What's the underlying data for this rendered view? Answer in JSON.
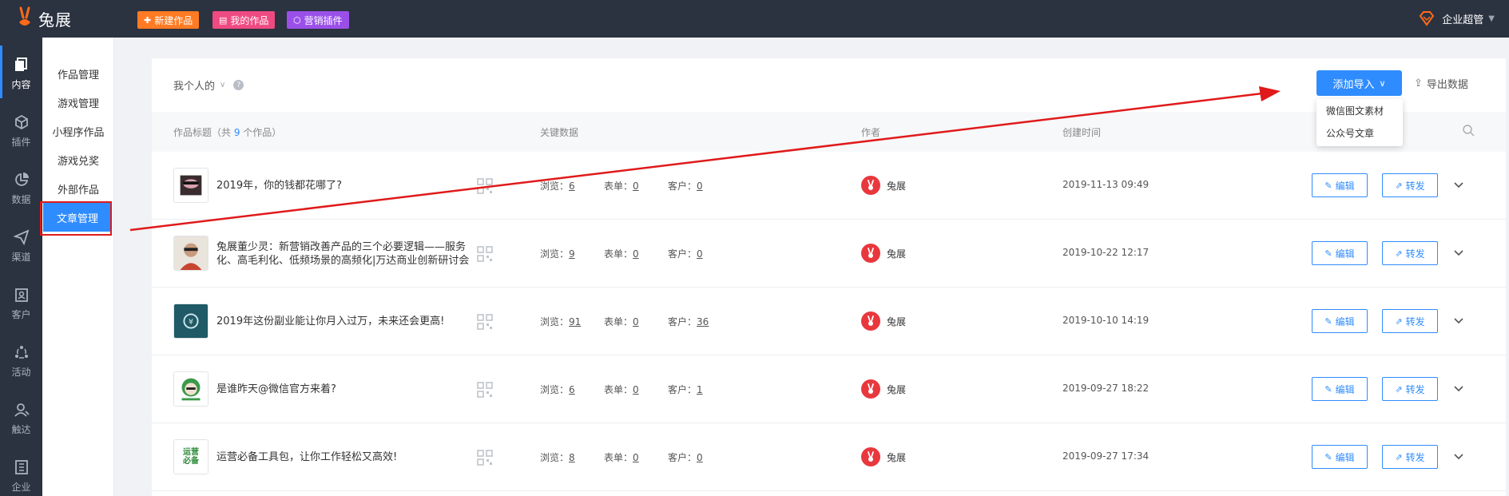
{
  "app": {
    "brand": "兔展"
  },
  "topbar": {
    "new_work": "新建作品",
    "my_works": "我的作品",
    "marketing_plugins": "营销插件",
    "user_label": "企业超管"
  },
  "rail": [
    {
      "label": "内容",
      "icon": "content-icon",
      "active": true
    },
    {
      "label": "插件",
      "icon": "plugin-icon"
    },
    {
      "label": "数据",
      "icon": "data-icon"
    },
    {
      "label": "渠道",
      "icon": "channel-icon"
    },
    {
      "label": "客户",
      "icon": "customer-icon"
    },
    {
      "label": "活动",
      "icon": "activity-icon"
    },
    {
      "label": "触达",
      "icon": "reach-icon"
    },
    {
      "label": "企业",
      "icon": "enterprise-icon"
    }
  ],
  "subnav": [
    {
      "label": "作品管理"
    },
    {
      "label": "游戏管理"
    },
    {
      "label": "小程序作品"
    },
    {
      "label": "游戏兑奖"
    },
    {
      "label": "外部作品"
    },
    {
      "label": "文章管理",
      "active": true
    }
  ],
  "toolbar": {
    "filter_label": "我个人的",
    "add_import": "添加导入",
    "export": "导出数据",
    "dropdown": [
      "微信图文素材",
      "公众号文章"
    ]
  },
  "table": {
    "col_title_prefix": "作品标题（共 ",
    "col_title_count": "9",
    "col_title_suffix": " 个作品）",
    "col_key_data": "关键数据",
    "col_author": "作者",
    "col_created": "创建时间",
    "views_label": "浏览：",
    "forms_label": "表单：",
    "customers_label": "客户：",
    "edit_label": "编辑",
    "share_label": "转发",
    "rows": [
      {
        "title": "2019年，你的钱都花哪了?",
        "views": "6",
        "forms": "0",
        "customers": "0",
        "author": "兔展",
        "created": "2019-11-13 09:49"
      },
      {
        "title": "兔展董少灵：新营销改善产品的三个必要逻辑——服务化、高毛利化、低频场景的高频化|万达商业创新研讨会",
        "views": "9",
        "forms": "0",
        "customers": "0",
        "author": "兔展",
        "created": "2019-10-22 12:17"
      },
      {
        "title": "2019年这份副业能让你月入过万，未来还会更高!",
        "views": "91",
        "forms": "0",
        "customers": "36",
        "author": "兔展",
        "created": "2019-10-10 14:19"
      },
      {
        "title": "是谁昨天@微信官方来着?",
        "views": "6",
        "forms": "0",
        "customers": "1",
        "author": "兔展",
        "created": "2019-09-27 18:22"
      },
      {
        "title": "运营必备工具包，让你工作轻松又高效!",
        "views": "8",
        "forms": "0",
        "customers": "0",
        "author": "兔展",
        "created": "2019-09-27 17:34",
        "thumb_text": "运营必备"
      }
    ]
  },
  "colors": {
    "primary": "#2f8cff",
    "dark": "#2b3240",
    "annotation": "#e01a1a"
  }
}
